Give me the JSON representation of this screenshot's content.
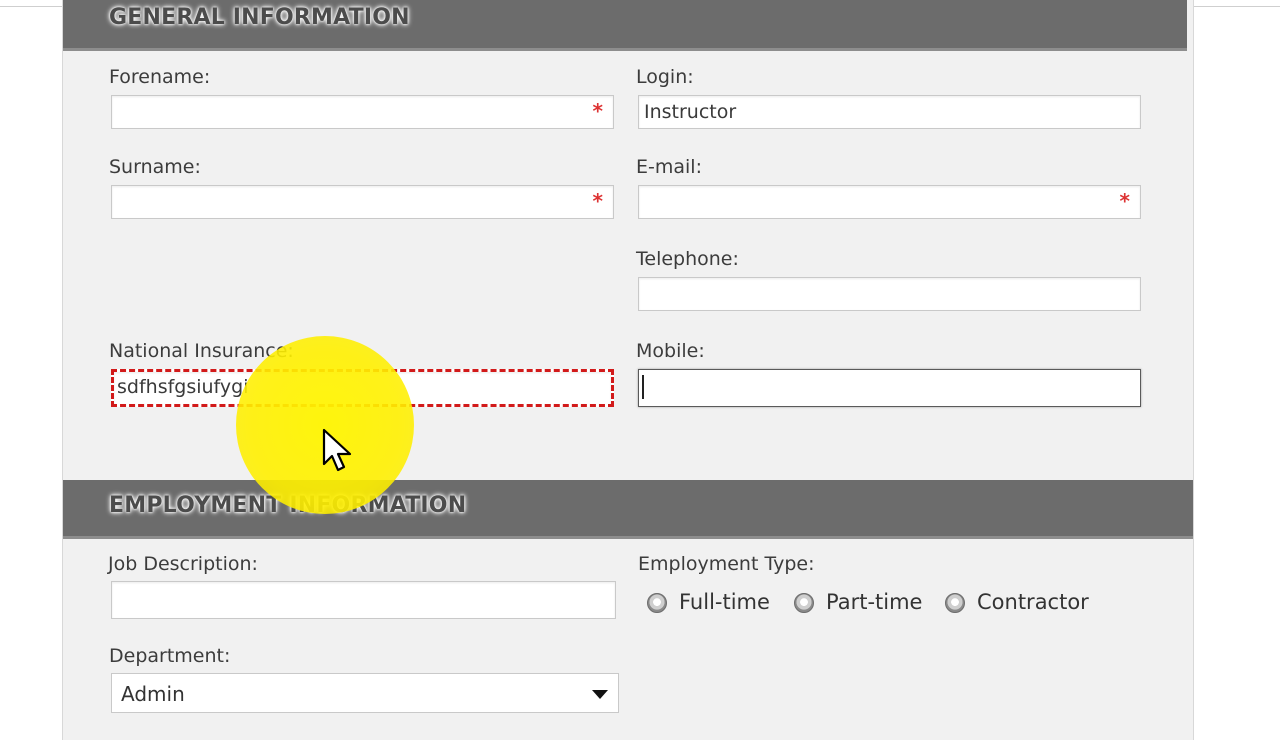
{
  "general": {
    "title": "GENERAL INFORMATION",
    "forename": {
      "label": "Forename:",
      "value": "",
      "required_mark": "*"
    },
    "surname": {
      "label": "Surname:",
      "value": "",
      "required_mark": "*"
    },
    "national_insurance": {
      "label": "National Insurance:",
      "value": "sdfhsfgsiufygi"
    },
    "login": {
      "label": "Login:",
      "value": "Instructor"
    },
    "email": {
      "label": "E-mail:",
      "value": "",
      "required_mark": "*"
    },
    "telephone": {
      "label": "Telephone:",
      "value": ""
    },
    "mobile": {
      "label": "Mobile:",
      "value": ""
    }
  },
  "employment": {
    "title": "EMPLOYMENT INFORMATION",
    "job_description": {
      "label": "Job Description:",
      "value": ""
    },
    "employment_type": {
      "label": "Employment Type:",
      "options": [
        "Full-time",
        "Part-time",
        "Contractor"
      ]
    },
    "department": {
      "label": "Department:",
      "selected": "Admin"
    }
  },
  "colors": {
    "header_bg": "#6c6c6c",
    "panel_bg": "#f1f1f1",
    "required": "#dd3333",
    "error_border": "#d21a1a",
    "cursor_highlight": "#fff200"
  },
  "icons": {
    "pointer": "mouse-pointer-icon",
    "dropdown": "chevron-down-icon"
  }
}
